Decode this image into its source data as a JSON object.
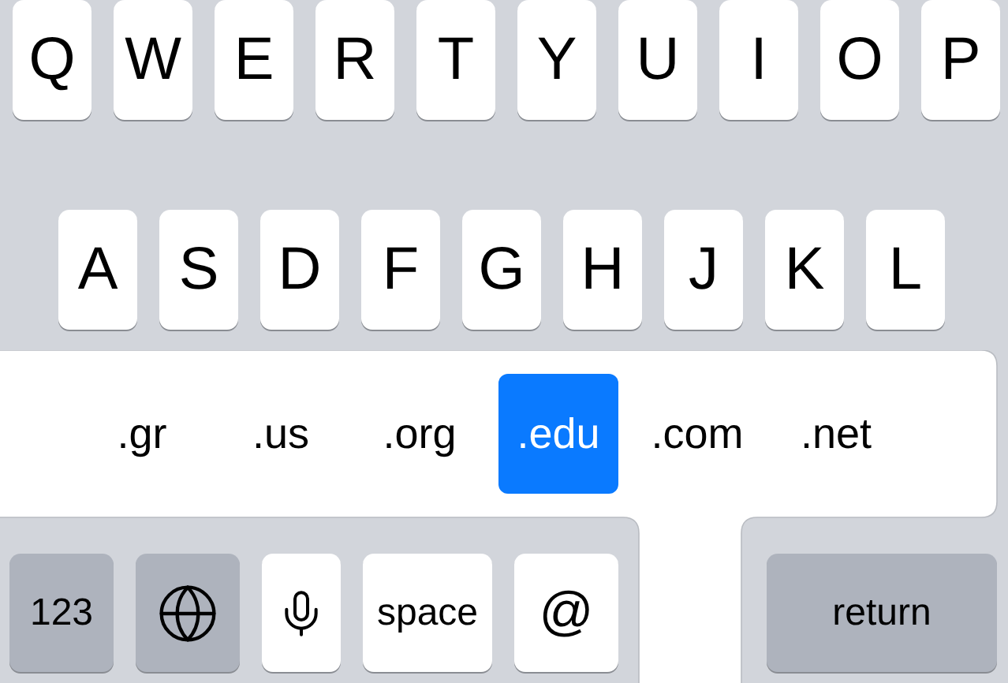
{
  "letter_rows": [
    [
      "Q",
      "W",
      "E",
      "R",
      "T",
      "Y",
      "U",
      "I",
      "O",
      "P"
    ],
    [
      "A",
      "S",
      "D",
      "F",
      "G",
      "H",
      "J",
      "K",
      "L"
    ]
  ],
  "domain_popup": {
    "options": [
      {
        "label": ".gr",
        "selected": false
      },
      {
        "label": ".us",
        "selected": false
      },
      {
        "label": ".org",
        "selected": false
      },
      {
        "label": ".edu",
        "selected": true
      },
      {
        "label": ".com",
        "selected": false
      },
      {
        "label": ".net",
        "selected": false
      }
    ]
  },
  "bottom_row": [
    {
      "kind": "label",
      "label": "123",
      "dark": true
    },
    {
      "kind": "globe",
      "dark": true
    },
    {
      "kind": "mic",
      "dark": false
    },
    {
      "kind": "label",
      "label": "space",
      "dark": false
    },
    {
      "kind": "label",
      "label": "@",
      "dark": false
    },
    {
      "kind": "label",
      "label": "return",
      "dark": true
    }
  ]
}
